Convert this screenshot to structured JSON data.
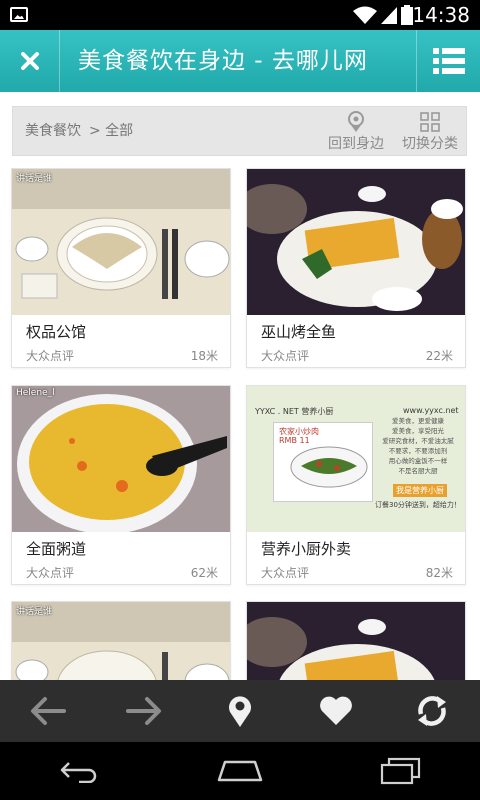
{
  "status_bar": {
    "time": "14:38"
  },
  "header": {
    "title": "美食餐饮在身边 - 去哪儿网"
  },
  "filter": {
    "breadcrumb_category": "美食餐饮",
    "breadcrumb_sub": "> 全部",
    "back_to_nearby": "回到身边",
    "switch_category": "切换分类"
  },
  "cards": [
    {
      "name": "权品公馆",
      "source": "大众点评",
      "distance": "18米",
      "watermark": "讲话是谁"
    },
    {
      "name": "巫山烤全鱼",
      "source": "大众点评",
      "distance": "22米",
      "watermark": ""
    },
    {
      "name": "全面粥道",
      "source": "大众点评",
      "distance": "62米",
      "watermark": "Helene_l"
    },
    {
      "name": "营养小厨外卖",
      "source": "大众点评",
      "distance": "82米",
      "watermark": ""
    },
    {
      "name": "",
      "source": "",
      "distance": "",
      "watermark": "讲话是谁"
    },
    {
      "name": "",
      "source": "",
      "distance": "",
      "watermark": ""
    }
  ],
  "menu_photo": {
    "header": "YYXC . NET   营养小厨",
    "site": "www.yyxc.net",
    "dish": "农家小炒肉",
    "price": "RMB 11",
    "slogan": "我是营养小厨",
    "lines": [
      "爱美食，更爱健康",
      "爱美食，享受阳光",
      "爱研究食材，不爱油太腻",
      "不要求，不要添加剂",
      "用心做的盒饭不一样",
      "不是名厨大厨"
    ],
    "footer": "订餐30分钟送到，超给力！"
  },
  "toolbar": {
    "icons": [
      "back-arrow-icon",
      "forward-arrow-icon",
      "location-pin-icon",
      "heart-icon",
      "refresh-icon"
    ]
  },
  "colors": {
    "header": "#29b3b5",
    "toolbar": "#2e2e2e"
  }
}
